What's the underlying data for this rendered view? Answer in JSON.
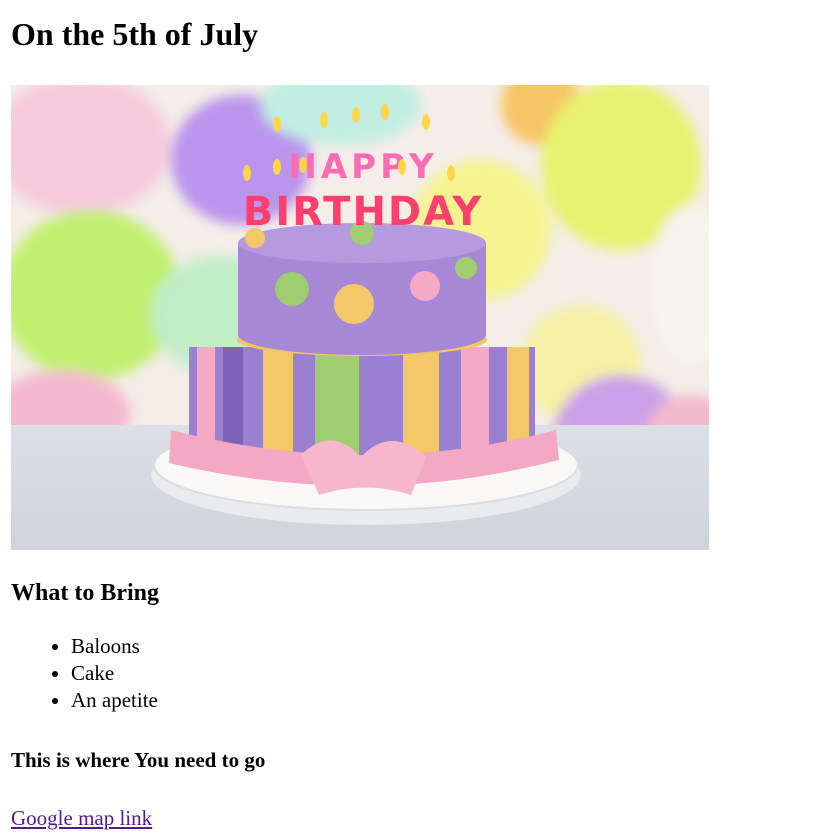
{
  "heading": "On the 5th of July",
  "image": {
    "alt": "Birthday cake with Happy Birthday candles",
    "candles": [
      "HAPPY",
      "BIRTHDAY"
    ]
  },
  "bring_heading": "What to Bring",
  "bring_items": [
    "Baloons",
    "Cake",
    "An apetite"
  ],
  "directions_heading": "This is where You need to go",
  "map_link_text": "Google map link",
  "colors": {
    "link_visited": "#551a8b",
    "cake_purple": "#9b7fd0",
    "ribbon_pink": "#f3a9c3"
  }
}
